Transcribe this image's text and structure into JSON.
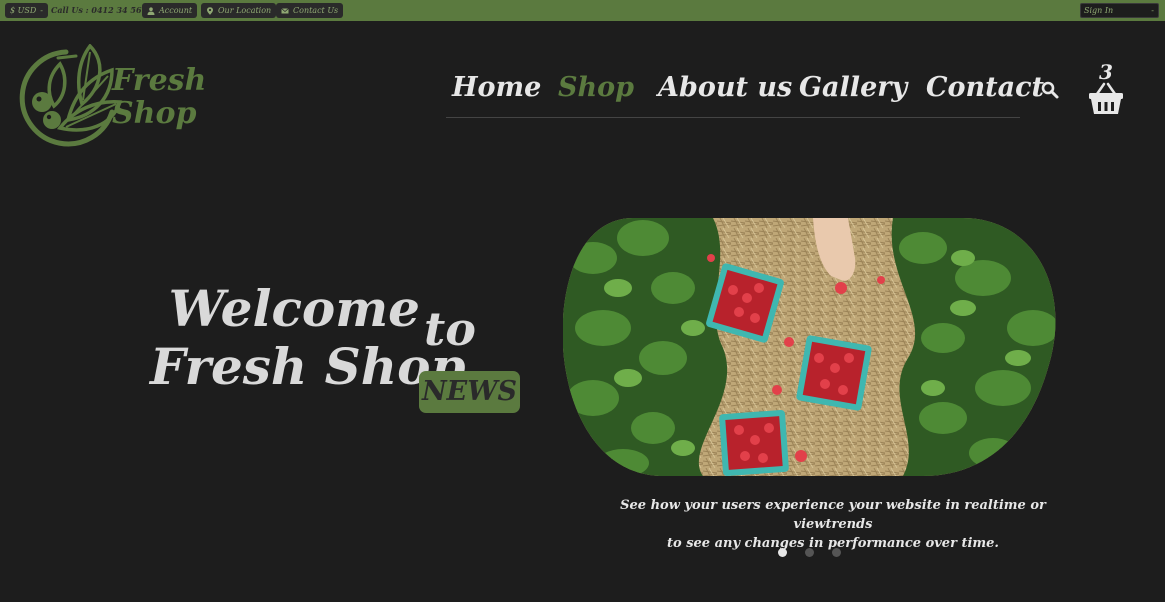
{
  "topbar": {
    "currency": "$ USD",
    "call_us": "Call Us : 0412 34 56 78",
    "account": "Account",
    "location": "Our Location",
    "contact": "Contact Us",
    "signin": "Sign In"
  },
  "logo": {
    "line1": "Fresh",
    "line2": "Shop"
  },
  "nav": {
    "items": [
      "Home",
      "Shop",
      "About us",
      "Gallery",
      "Contact"
    ],
    "active": "Shop"
  },
  "cart": {
    "count": "3"
  },
  "hero": {
    "title_line1": "Welcome",
    "title_line2": "Fresh Shop",
    "to": "to",
    "badge": "NEWS",
    "caption_line1": "See how your users experience your website in realtime or viewtrends",
    "caption_line2": "to see any changes in performance over time."
  },
  "slider": {
    "active_index": 0
  },
  "colors": {
    "brand_green": "#5b7a3f",
    "background": "#1d1d1d",
    "text_light": "#e7e7e7"
  },
  "icons": [
    "user-icon",
    "location-pin-icon",
    "envelope-icon",
    "search-icon",
    "shopping-basket-icon"
  ]
}
